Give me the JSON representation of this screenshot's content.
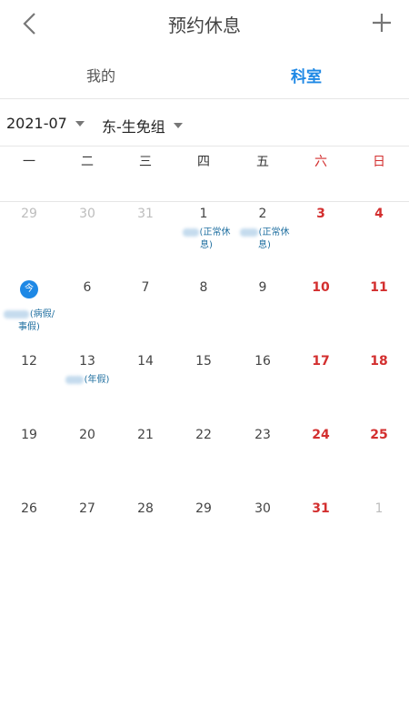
{
  "header": {
    "title": "预约休息",
    "back_icon": "chevron-left-icon",
    "add_icon": "plus-icon"
  },
  "tabs": {
    "mine": "我的",
    "dept": "科室",
    "active": "dept"
  },
  "filters": {
    "month": "2021-07",
    "group": "东-生免组"
  },
  "weekdays": [
    "一",
    "二",
    "三",
    "四",
    "五",
    "六",
    "日"
  ],
  "calendar": {
    "today_label": "今",
    "weeks": [
      [
        "29",
        "30",
        "31",
        "1",
        "2",
        "3",
        "4"
      ],
      [
        "今",
        "6",
        "7",
        "8",
        "9",
        "10",
        "11"
      ],
      [
        "12",
        "13",
        "14",
        "15",
        "16",
        "17",
        "18"
      ],
      [
        "19",
        "20",
        "21",
        "22",
        "23",
        "24",
        "25"
      ],
      [
        "26",
        "27",
        "28",
        "29",
        "30",
        "31",
        "1"
      ]
    ],
    "notes": {
      "jul1": "(正常休\n息)",
      "jul2": "(正常休\n息)",
      "jul5_line1": "(病假/",
      "jul5_line2": "事假)",
      "jul13": "(年假)"
    }
  },
  "colors": {
    "accent": "#1e88e5",
    "weekend": "#d32f2f",
    "muted": "#bdbdbd"
  }
}
